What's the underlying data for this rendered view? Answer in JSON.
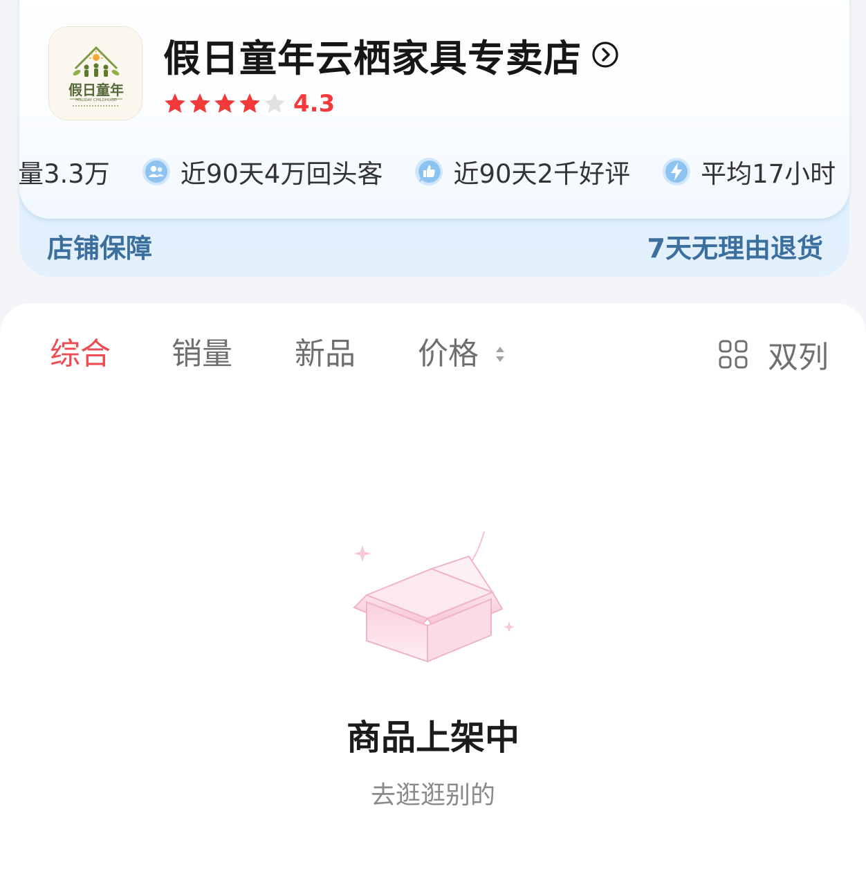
{
  "store": {
    "name": "假日童年云栖家具专卖店",
    "rating": "4.3",
    "rating_stars": 4.3,
    "logo": {
      "icon": "holiday-childhood-logo",
      "text_cn": "假日童年",
      "text_en": "HOLIDAY CHILDHOOD"
    },
    "stats": [
      {
        "icon": "",
        "text": "量3.3万"
      },
      {
        "icon": "users-icon",
        "text": "近90天4万回头客"
      },
      {
        "icon": "thumbs-up-icon",
        "text": "近90天2千好评"
      },
      {
        "icon": "lightning-icon",
        "text": "平均17小时"
      }
    ],
    "guarantee": {
      "label": "店铺保障",
      "value": "7天无理由退货"
    }
  },
  "sort_tabs": {
    "composite": "综合",
    "sales": "销量",
    "new": "新品",
    "price": "价格",
    "view_toggle": "双列"
  },
  "empty_state": {
    "title": "商品上架中",
    "subtitle": "去逛逛别的"
  },
  "colors": {
    "accent_red": "#ec4d55",
    "rating_red": "#f23a3a",
    "guarantee_blue": "#3c6f9d",
    "stat_icon_blue": "#8cc3f1",
    "empty_box_pink": "#f7c6d8"
  }
}
